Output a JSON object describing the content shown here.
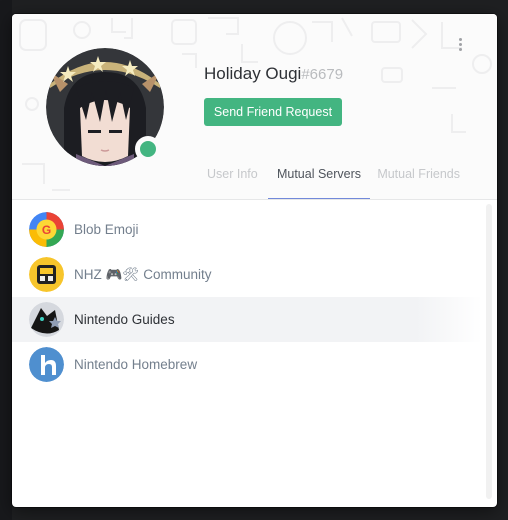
{
  "profile": {
    "username": "Holiday Ougi",
    "discriminator": "#6679",
    "status": "online",
    "status_color": "#43b581",
    "avatar_icon": "anime-avatar-icon"
  },
  "actions": {
    "send_friend_request_label": "Send Friend Request",
    "menu_icon": "kebab-menu-icon"
  },
  "tabs": [
    {
      "label": "User Info",
      "active": false
    },
    {
      "label": "Mutual Servers",
      "active": true
    },
    {
      "label": "Mutual Friends",
      "active": false
    }
  ],
  "mutual_servers": [
    {
      "name": "Blob Emoji",
      "icon": "blob-emoji-server-icon",
      "selected": false
    },
    {
      "name": "NHZ 🎮🛠 Community",
      "icon": "nhz-community-server-icon",
      "selected": false
    },
    {
      "name": "Nintendo Guides",
      "icon": "nintendo-guides-server-icon",
      "selected": true
    },
    {
      "name": "Nintendo Homebrew",
      "icon": "nintendo-homebrew-server-icon",
      "selected": false
    }
  ],
  "colors": {
    "accent": "#7289da",
    "button_green": "#43b581"
  }
}
